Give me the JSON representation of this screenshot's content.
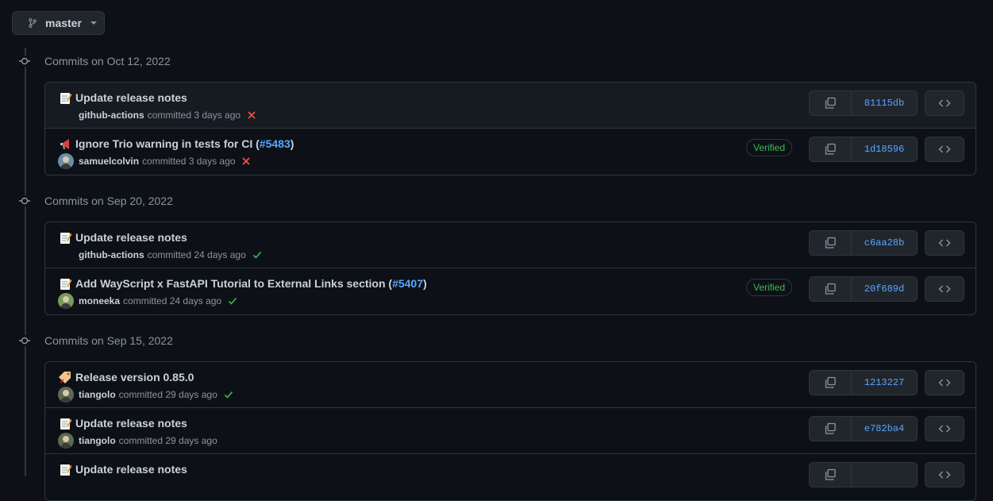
{
  "branch": {
    "label": "master"
  },
  "days": [
    {
      "title": "Commits on Oct 12, 2022",
      "commits": [
        {
          "emoji_icon": "memo-icon",
          "message": "Update release notes",
          "pr": "",
          "author": "github-actions",
          "time": "committed 3 days ago",
          "status": "fail",
          "verified": "",
          "sha": "81115db",
          "avatar": false
        },
        {
          "emoji_icon": "loudspeaker-icon",
          "message": "Ignore Trio warning in tests for CI (",
          "pr": "#5483",
          "pr_close": ")",
          "author": "samuelcolvin",
          "time": "committed 3 days ago",
          "status": "fail",
          "verified": "Verified",
          "sha": "1d18596",
          "avatar": true
        }
      ]
    },
    {
      "title": "Commits on Sep 20, 2022",
      "commits": [
        {
          "emoji_icon": "memo-icon",
          "message": "Update release notes",
          "pr": "",
          "author": "github-actions",
          "time": "committed 24 days ago",
          "status": "success",
          "verified": "",
          "sha": "c6aa28b",
          "avatar": false
        },
        {
          "emoji_icon": "memo-icon",
          "message": "Add WayScript x FastAPI Tutorial to External Links section (",
          "pr": "#5407",
          "pr_close": ")",
          "author": "moneeka",
          "time": "committed 24 days ago",
          "status": "success",
          "verified": "Verified",
          "sha": "20f689d",
          "avatar": true
        }
      ]
    },
    {
      "title": "Commits on Sep 15, 2022",
      "commits": [
        {
          "emoji_icon": "bookmark-tag-icon",
          "message": "Release version 0.85.0",
          "pr": "",
          "author": "tiangolo",
          "time": "committed 29 days ago",
          "status": "success",
          "verified": "",
          "sha": "1213227",
          "avatar": true
        },
        {
          "emoji_icon": "memo-icon",
          "message": "Update release notes",
          "pr": "",
          "author": "tiangolo",
          "time": "committed 29 days ago",
          "status": "none",
          "verified": "",
          "sha": "e782ba4",
          "avatar": true
        },
        {
          "emoji_icon": "memo-icon",
          "message": "Update release notes",
          "pr": "",
          "author": "",
          "time": "",
          "status": "none",
          "verified": "",
          "sha": "",
          "avatar": false
        }
      ]
    }
  ],
  "colors": {
    "fail": "#f85149",
    "success": "#3fb950",
    "link": "#58a6ff"
  }
}
